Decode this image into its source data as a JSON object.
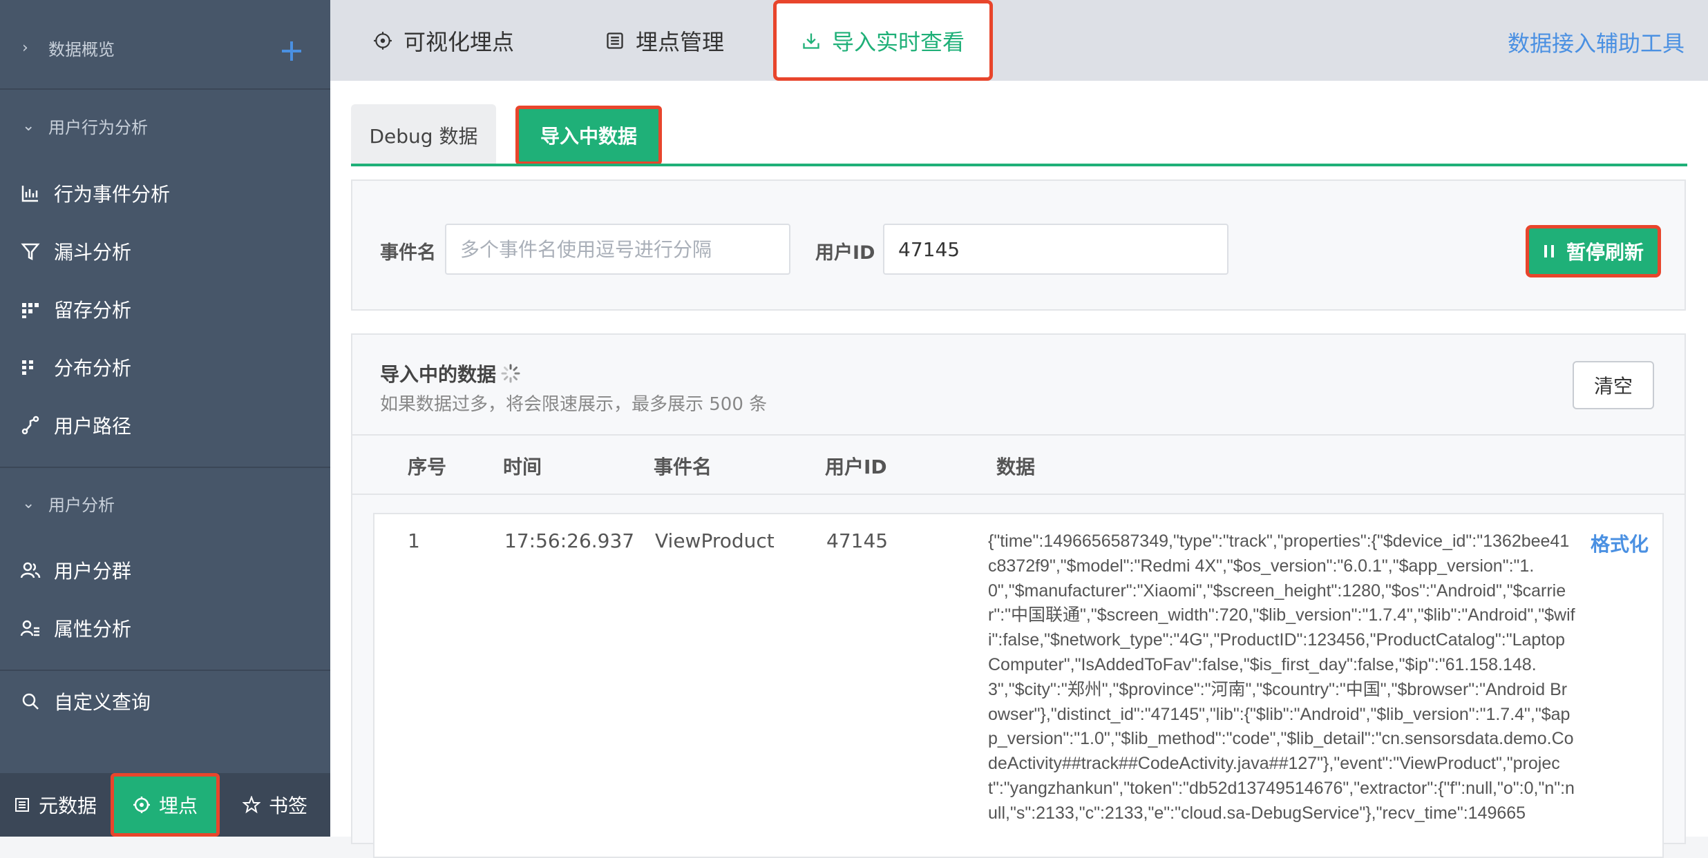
{
  "sidebar": {
    "sections": [
      {
        "label": "数据概览"
      },
      {
        "label": "用户行为分析"
      },
      {
        "label": "用户分析"
      }
    ],
    "items": [
      {
        "label": "行为事件分析",
        "icon": "bar-chart-icon"
      },
      {
        "label": "漏斗分析",
        "icon": "funnel-icon"
      },
      {
        "label": "留存分析",
        "icon": "retention-icon"
      },
      {
        "label": "分布分析",
        "icon": "distribution-icon"
      },
      {
        "label": "用户路径",
        "icon": "path-icon"
      },
      {
        "label": "用户分群",
        "icon": "users-icon"
      },
      {
        "label": "属性分析",
        "icon": "user-attribute-icon"
      },
      {
        "label": "自定义查询",
        "icon": "search-icon"
      }
    ],
    "bottom_tabs": [
      {
        "label": "元数据",
        "icon": "list-icon"
      },
      {
        "label": "埋点",
        "icon": "target-icon"
      },
      {
        "label": "书签",
        "icon": "star-icon"
      }
    ]
  },
  "topbar": {
    "tabs": [
      {
        "label": "可视化埋点",
        "icon": "target-icon"
      },
      {
        "label": "埋点管理",
        "icon": "list-icon"
      },
      {
        "label": "导入实时查看",
        "icon": "download-icon"
      }
    ],
    "link": "数据接入辅助工具"
  },
  "subtabs": [
    "Debug 数据",
    "导入中数据"
  ],
  "filter": {
    "event_label": "事件名",
    "event_placeholder": "多个事件名使用逗号进行分隔",
    "event_value": "",
    "user_label": "用户ID",
    "user_value": "47145",
    "pause_label": "暂停刷新"
  },
  "panel": {
    "title": "导入中的数据",
    "subtitle": "如果数据过多，将会限速展示，最多展示 500 条",
    "clear_label": "清空",
    "columns": [
      "序号",
      "时间",
      "事件名",
      "用户ID",
      "数据"
    ],
    "rows": [
      {
        "index": "1",
        "time": "17:56:26.937",
        "event": "ViewProduct",
        "user_id": "47145",
        "data": "{\"time\":1496656587349,\"type\":\"track\",\"properties\":{\"$device_id\":\"1362bee41c8372f9\",\"$model\":\"Redmi 4X\",\"$os_version\":\"6.0.1\",\"$app_version\":\"1.0\",\"$manufacturer\":\"Xiaomi\",\"$screen_height\":1280,\"$os\":\"Android\",\"$carrier\":\"中国联通\",\"$screen_width\":720,\"$lib_version\":\"1.7.4\",\"$lib\":\"Android\",\"$wifi\":false,\"$network_type\":\"4G\",\"ProductID\":123456,\"ProductCatalog\":\"Laptop Computer\",\"IsAddedToFav\":false,\"$is_first_day\":false,\"$ip\":\"61.158.148.3\",\"$city\":\"郑州\",\"$province\":\"河南\",\"$country\":\"中国\",\"$browser\":\"Android Browser\"},\"distinct_id\":\"47145\",\"lib\":{\"$lib\":\"Android\",\"$lib_version\":\"1.7.4\",\"$app_version\":\"1.0\",\"$lib_method\":\"code\",\"$lib_detail\":\"cn.sensorsdata.demo.CodeActivity##track##CodeActivity.java##127\"},\"event\":\"ViewProduct\",\"project\":\"yangzhankun\",\"token\":\"db52d13749514676\",\"extractor\":{\"f\":null,\"o\":0,\"n\":null,\"s\":2133,\"c\":2133,\"e\":\"cloud.sa-DebugService\"},\"recv_time\":149665",
        "format_label": "格式化"
      }
    ]
  },
  "colors": {
    "sidebar": "#475669",
    "accent": "#1fb078",
    "highlight": "#e8452c",
    "link": "#4a90e2"
  }
}
